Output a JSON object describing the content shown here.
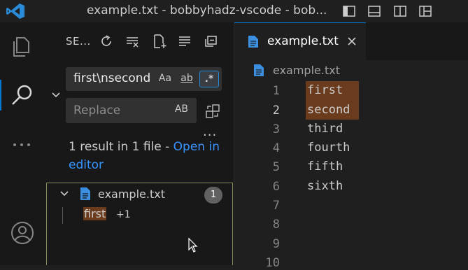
{
  "window": {
    "title": "example.txt - bobbyhadz-vscode - bob..."
  },
  "titlebar_icons": [
    "toggle-primary-sidebar-icon",
    "toggle-panel-icon",
    "toggle-secondary-sidebar-icon",
    "customize-layout-icon"
  ],
  "activity_bar": [
    "explorer-icon",
    "search-icon",
    "more-icon",
    "account-icon"
  ],
  "search_view": {
    "title": "SE...",
    "toolbar_icons": [
      "refresh-icon",
      "clear-results-icon",
      "new-search-editor-icon",
      "view-as-tree-icon",
      "collapse-all-icon"
    ],
    "query": "first\\nsecond",
    "match_case_label": "Aa",
    "whole_word_label": "ab",
    "regex_label": ".*",
    "replace_placeholder": "Replace",
    "preserve_case_label": "AB",
    "more_label": "...",
    "results_text": "1 result in 1 file - ",
    "open_in_editor": "Open in editor",
    "result_file": {
      "name": "example.txt",
      "count": "1"
    },
    "match": {
      "word": "first",
      "more": "+1"
    }
  },
  "editor": {
    "tab_label": "example.txt",
    "breadcrumb": "example.txt",
    "line_numbers": [
      "1",
      "2",
      "3",
      "4",
      "5",
      "6",
      "7",
      "8",
      "9",
      "10"
    ],
    "lines": [
      "first",
      "second",
      "third",
      "fourth",
      "fifth",
      "sixth",
      "",
      "",
      "",
      ""
    ]
  },
  "colors": {
    "accent": "#0078d4",
    "link": "#3794ff",
    "match_highlight": "#6b3b1e",
    "file_icon": "#3c8ee0"
  }
}
